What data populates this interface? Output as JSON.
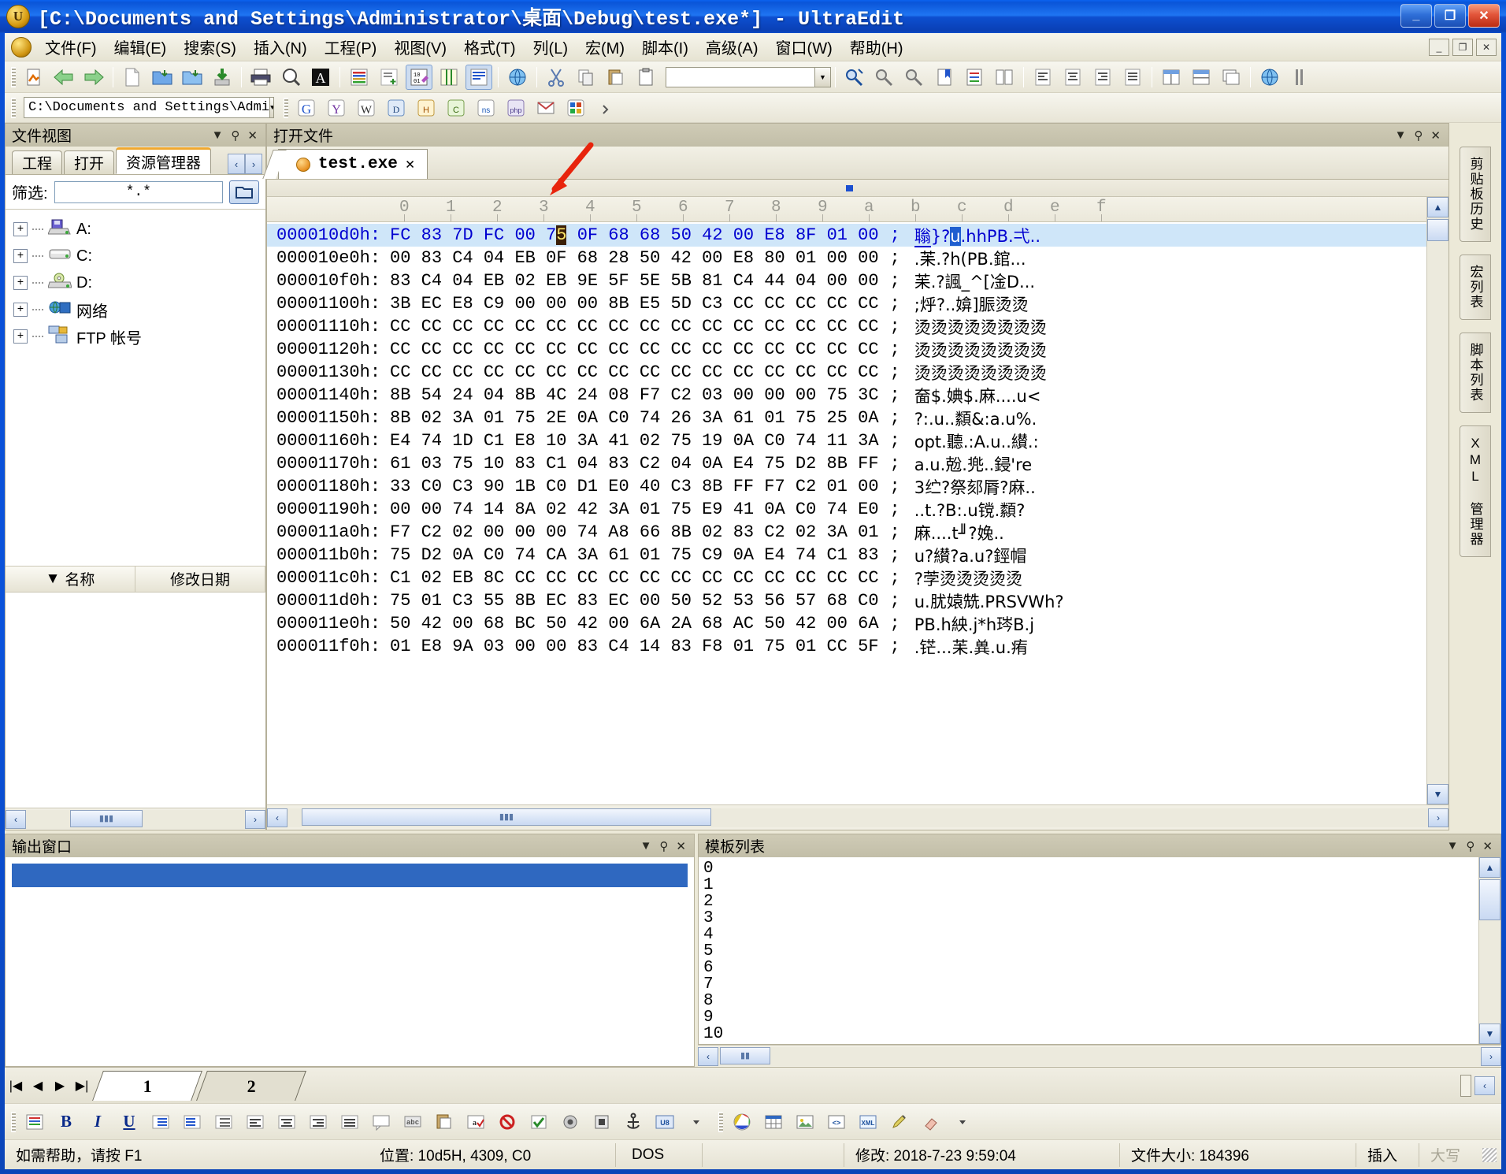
{
  "window": {
    "title": "[C:\\Documents and Settings\\Administrator\\桌面\\Debug\\test.exe*] - UltraEdit",
    "app_icon": "ultraedit-logo-icon",
    "minimize_label": "_",
    "maximize_label": "❐",
    "close_label": "✕"
  },
  "menu": {
    "items": [
      {
        "label": "文件(F)"
      },
      {
        "label": "编辑(E)"
      },
      {
        "label": "搜索(S)"
      },
      {
        "label": "插入(N)"
      },
      {
        "label": "工程(P)"
      },
      {
        "label": "视图(V)"
      },
      {
        "label": "格式(T)"
      },
      {
        "label": "列(L)"
      },
      {
        "label": "宏(M)"
      },
      {
        "label": "脚本(I)"
      },
      {
        "label": "高级(A)"
      },
      {
        "label": "窗口(W)"
      },
      {
        "label": "帮助(H)"
      }
    ],
    "doc_min": "_",
    "doc_restore": "❐",
    "doc_close": "✕"
  },
  "toolbar2": {
    "path_value": "C:\\Documents and Settings\\Admi",
    "dropdown_arrow": "▼"
  },
  "fileview": {
    "caption": "文件视图",
    "caption_menu": "▼",
    "caption_pin": "⚲",
    "caption_close": "✕",
    "tabs": [
      {
        "label": "工程",
        "active": false
      },
      {
        "label": "打开",
        "active": false
      },
      {
        "label": "资源管理器",
        "active": true
      }
    ],
    "nav_prev": "‹",
    "nav_next": "›",
    "filter_label": "筛选:",
    "filter_value": "*.*",
    "browse_icon": "folder-open-icon",
    "tree": [
      {
        "label": "A:",
        "icon": "floppy-drive-icon",
        "expander": "+"
      },
      {
        "label": "C:",
        "icon": "hard-drive-icon",
        "expander": "+"
      },
      {
        "label": "D:",
        "icon": "cd-drive-icon",
        "expander": "+"
      },
      {
        "label": "网络",
        "icon": "network-icon",
        "expander": "+"
      },
      {
        "label": "FTP 帐号",
        "icon": "ftp-account-icon",
        "expander": "+"
      }
    ],
    "sort_columns": [
      {
        "label": "名称",
        "sort_arrow": "▼"
      },
      {
        "label": "修改日期",
        "sort_arrow": ""
      }
    ],
    "hscroll_left": "‹",
    "hscroll_right": "›"
  },
  "editor": {
    "caption": "打开文件",
    "caption_menu": "▼",
    "caption_pin": "⚲",
    "caption_close": "✕",
    "tab": {
      "label": "test.exe",
      "icon": "orange-dot-icon",
      "close": "✕"
    },
    "ruler": [
      "0",
      "1",
      "2",
      "3",
      "4",
      "5",
      "6",
      "7",
      "8",
      "9",
      "a",
      "b",
      "c",
      "d",
      "e",
      "f"
    ],
    "cursor_nibble": "5",
    "cursor_col_index": 5,
    "rows": [
      {
        "addr": "000010d0h:",
        "bytes": "FC 83 7D FC 00 75 0F 68 68 50 42 00 E8 8F 01 00",
        "ascii": "聬}?u.hhPB.弌..",
        "selected": true
      },
      {
        "addr": "000010e0h:",
        "bytes": "00 83 C4 04 EB 0F 68 28 50 42 00 E8 80 01 00 00",
        "ascii": ".苿.?h(PB.錧...",
        "selected": false
      },
      {
        "addr": "000010f0h:",
        "bytes": "83 C4 04 EB 02 EB 9E 5F 5E 5B 81 C4 44 04 00 00",
        "ascii": "苿.?諷_^[凎D...",
        "selected": false
      },
      {
        "addr": "00001100h:",
        "bytes": "3B EC E8 C9 00 00 00 8B E5 5D C3 CC CC CC CC CC",
        "ascii": ";烀?..媕]脤烫烫",
        "selected": false
      },
      {
        "addr": "00001110h:",
        "bytes": "CC CC CC CC CC CC CC CC CC CC CC CC CC CC CC CC",
        "ascii": "烫烫烫烫烫烫烫烫",
        "selected": false
      },
      {
        "addr": "00001120h:",
        "bytes": "CC CC CC CC CC CC CC CC CC CC CC CC CC CC CC CC",
        "ascii": "烫烫烫烫烫烫烫烫",
        "selected": false
      },
      {
        "addr": "00001130h:",
        "bytes": "CC CC CC CC CC CC CC CC CC CC CC CC CC CC CC CC",
        "ascii": "烫烫烫烫烫烫烫烫",
        "selected": false
      },
      {
        "addr": "00001140h:",
        "bytes": "8B 54 24 04 8B 4C 24 08 F7 C2 03 00 00 00 75 3C",
        "ascii": "奤$.婰$.麻....u<",
        "selected": false
      },
      {
        "addr": "00001150h:",
        "bytes": "8B 02 3A 01 75 2E 0A C0 74 26 3A 61 01 75 25 0A",
        "ascii": "?:.u..纇&:a.u%.",
        "selected": false
      },
      {
        "addr": "00001160h:",
        "bytes": "E4 74 1D C1 E8 10 3A 41 02 75 19 0A C0 74 11 3A",
        "ascii": "орt.聽.:A.u..纉.:",
        "selected": false
      },
      {
        "addr": "00001170h:",
        "bytes": "61 03 75 10 83 C1 04 83 C2 04 0A E4 75 D2 8B FF",
        "ascii": "a.u.兝.兠..鋟're",
        "selected": false
      },
      {
        "addr": "00001180h:",
        "bytes": "33 C0 C3 90 1B C0 D1 E0 40 C3 8B FF F7 C2 01 00",
        "ascii": "3纻?祭郂脣?麻..",
        "selected": false
      },
      {
        "addr": "00001190h:",
        "bytes": "00 00 74 14 8A 02 42 3A 01 75 E9 41 0A C0 74 E0",
        "ascii": "..t.?B:.u镋.纇?",
        "selected": false
      },
      {
        "addr": "000011a0h:",
        "bytes": "F7 C2 02 00 00 00 74 A8 66 8B 02 83 C2 02 3A 01",
        "ascii": "麻....t╜?婏..",
        "selected": false
      },
      {
        "addr": "000011b0h:",
        "bytes": "75 D2 0A C0 74 CA 3A 61 01 75 C9 0A E4 74 C1 83",
        "ascii": "u?纉?a.u?鋞帽",
        "selected": false
      },
      {
        "addr": "000011c0h:",
        "bytes": "C1 02 EB 8C CC CC CC CC CC CC CC CC CC CC CC CC",
        "ascii": "?茡烫烫烫烫烫",
        "selected": false
      },
      {
        "addr": "000011d0h:",
        "bytes": "75 01 C3 55 8B EC 83 EC 00 50 52 53 56 57 68 C0",
        "ascii": "u.肬媴兟.PRSVWh?",
        "selected": false
      },
      {
        "addr": "000011e0h:",
        "bytes": "50 42 00 68 BC 50 42 00 6A 2A 68 AC 50 42 00 6A",
        "ascii": "PB.h紻.j*h琌B.j",
        "selected": false
      },
      {
        "addr": "000011f0h:",
        "bytes": "01 E8 9A 03 00 00 83 C4 14 83 F8 01 75 01 CC 5F",
        "ascii": ".铓...苿.兾.u.痏",
        "selected": false
      }
    ],
    "semicolon": ";",
    "scroll_up": "▲",
    "scroll_down": "▼",
    "scroll_left": "‹",
    "scroll_right": "›"
  },
  "output_pane": {
    "caption": "输出窗口",
    "caption_menu": "▼",
    "caption_pin": "⚲",
    "caption_close": "✕"
  },
  "template_pane": {
    "caption": "模板列表",
    "caption_menu": "▼",
    "caption_pin": "⚲",
    "caption_close": "✕",
    "items": [
      "0",
      "1",
      "2",
      "3",
      "4",
      "5",
      "6",
      "7",
      "8",
      "9",
      "10"
    ],
    "scroll_up": "▲",
    "scroll_down": "▼",
    "scroll_left": "‹",
    "scroll_right": "›"
  },
  "page_tabs": {
    "first": "|◀",
    "prev": "◀",
    "next": "▶",
    "last": "▶|",
    "tabs": [
      {
        "label": "1",
        "active": true
      },
      {
        "label": "2",
        "active": false
      }
    ],
    "scroll_left": "‹"
  },
  "right_rail": {
    "tabs": [
      "剪贴板历史",
      "宏列表",
      "脚本列表",
      "XML 管理器"
    ]
  },
  "format_bar": {
    "buttons": [
      "B",
      "I",
      "U"
    ]
  },
  "statusbar": {
    "help_text": "如需帮助，请按 F1",
    "position": "位置: 10d5H, 4309, C0",
    "mode": "DOS",
    "modified": "修改: 2018-7-23 9:59:04",
    "filesize": "文件大小: 184396",
    "insert": "插入",
    "caps": "大写"
  },
  "colors": {
    "title_blue": "#0a52db",
    "selection_row": "#cfe6f9",
    "hex_blue_text": "#0000d0",
    "cursor_bg": "#3b2008",
    "cursor_fg": "#ffe76a",
    "ascii_sel_bg": "#1f5fd0",
    "tab_accent": "#f0a830",
    "output_sel": "#2f68c0",
    "arrow_red": "#e8240c"
  }
}
